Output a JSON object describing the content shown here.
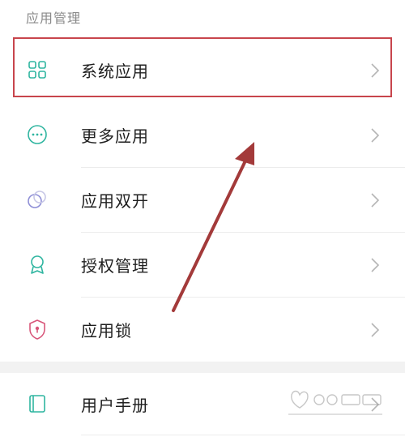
{
  "section": {
    "title": "应用管理"
  },
  "items": [
    {
      "label": "系统应用",
      "icon": "grid-icon"
    },
    {
      "label": "更多应用",
      "icon": "more-icon"
    },
    {
      "label": "应用双开",
      "icon": "dual-circles-icon"
    },
    {
      "label": "授权管理",
      "icon": "badge-icon"
    },
    {
      "label": "应用锁",
      "icon": "shield-lock-icon"
    },
    {
      "label": "用户手册",
      "icon": "book-icon"
    }
  ],
  "colors": {
    "accent": "#2fb5a0",
    "highlight": "#c8454c",
    "arrow": "#a33a3a",
    "lock": "#d8567a"
  }
}
